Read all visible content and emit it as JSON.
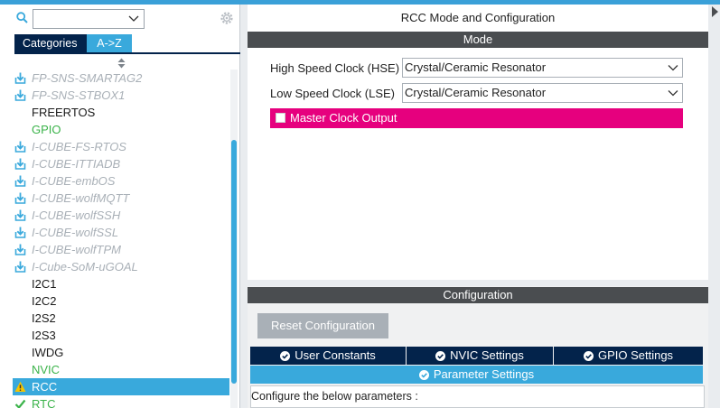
{
  "left_panel": {
    "search": {
      "value": "",
      "placeholder": ""
    },
    "tabs": [
      {
        "label": "Categories"
      },
      {
        "label": "A->Z"
      }
    ],
    "items": [
      {
        "label": "FP-SNS-SMARTAG2",
        "kind": "ext"
      },
      {
        "label": "FP-SNS-STBOX1",
        "kind": "ext"
      },
      {
        "label": "FREERTOS",
        "kind": "normal"
      },
      {
        "label": "GPIO",
        "kind": "green"
      },
      {
        "label": "I-CUBE-FS-RTOS",
        "kind": "ext"
      },
      {
        "label": "I-CUBE-ITTIADB",
        "kind": "ext"
      },
      {
        "label": "I-CUBE-embOS",
        "kind": "ext"
      },
      {
        "label": "I-CUBE-wolfMQTT",
        "kind": "ext"
      },
      {
        "label": "I-CUBE-wolfSSH",
        "kind": "ext"
      },
      {
        "label": "I-CUBE-wolfSSL",
        "kind": "ext"
      },
      {
        "label": "I-CUBE-wolfTPM",
        "kind": "ext"
      },
      {
        "label": "I-Cube-SoM-uGOAL",
        "kind": "ext"
      },
      {
        "label": "I2C1",
        "kind": "normal"
      },
      {
        "label": "I2C2",
        "kind": "normal"
      },
      {
        "label": "I2S2",
        "kind": "normal"
      },
      {
        "label": "I2S3",
        "kind": "normal"
      },
      {
        "label": "IWDG",
        "kind": "normal"
      },
      {
        "label": "NVIC",
        "kind": "green"
      },
      {
        "label": "RCC",
        "kind": "selected"
      },
      {
        "label": "RTC",
        "kind": "green-check"
      }
    ]
  },
  "mode_panel": {
    "title": "RCC Mode and Configuration",
    "mode_bar": "Mode",
    "hse_label": "High Speed Clock (HSE)",
    "hse_value": "Crystal/Ceramic Resonator",
    "lse_label": "Low Speed Clock (LSE)",
    "lse_value": "Crystal/Ceramic Resonator",
    "mco_label": "Master Clock Output"
  },
  "config_panel": {
    "bar": "Configuration",
    "reset_label": "Reset Configuration",
    "tabs": [
      "User Constants",
      "NVIC Settings",
      "GPIO Settings"
    ],
    "param_tab": "Parameter Settings",
    "instruction": "Configure the below parameters :"
  },
  "colors": {
    "accent": "#39a9dc",
    "navy": "#03234b",
    "magenta": "#e6007e",
    "ext_text": "#a9b0b7",
    "ok_text": "#3bb34a",
    "warning": "#f5c400"
  }
}
